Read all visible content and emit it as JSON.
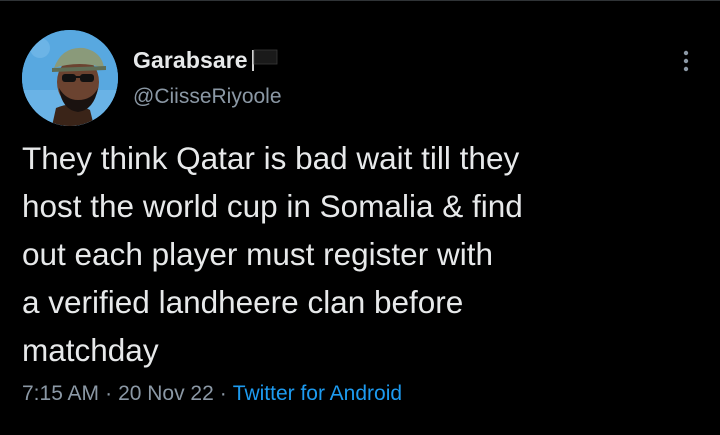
{
  "tweet": {
    "author": {
      "display_name": "Garabsare",
      "handle": "@CiisseRiyoole",
      "name_emoji": "black-flag-icon",
      "avatar": "profile-photo"
    },
    "menu_icon": "more-vertical-icon",
    "text": "They think Qatar is bad wait till they\nhost the world cup in Somalia & find\nout each player must register with\na verified landheere clan before\nmatchday",
    "time": "7:15 AM",
    "separator": "·",
    "date": "20 Nov 22",
    "source": "Twitter for Android"
  },
  "colors": {
    "background": "#000000",
    "text_primary": "#e7e9ea",
    "text_secondary": "#8b98a5",
    "link": "#1d9bf0"
  }
}
